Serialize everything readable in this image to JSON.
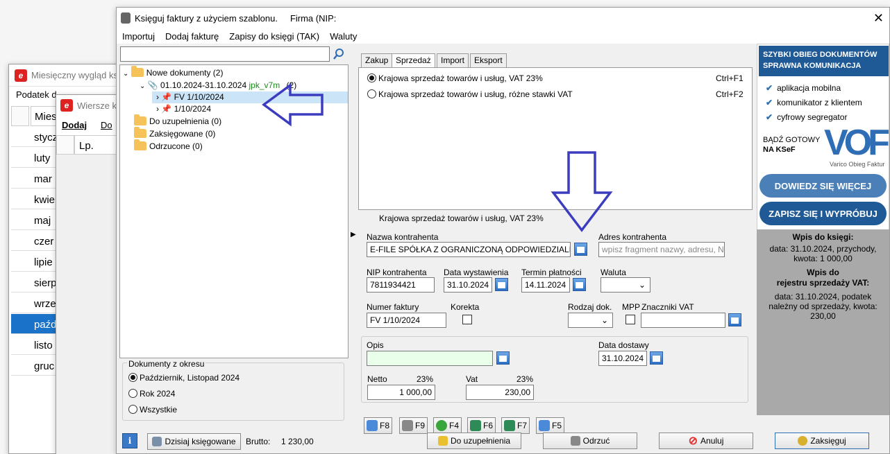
{
  "back_window": {
    "title": "Miesięczny wygląd ks",
    "menu_item": "Podatek d",
    "column_header": "Mies",
    "months": [
      "stycz",
      "luty",
      "mar",
      "kwie",
      "maj",
      "czer",
      "lipie",
      "sierp",
      "wrze",
      "paźd",
      "listo",
      "gruc"
    ],
    "selected_index": 9
  },
  "middle_window": {
    "title": "Wiersze k",
    "menu": [
      "Dodaj",
      "Do"
    ],
    "column_header": "Lp."
  },
  "main": {
    "title": "Księguj faktury z użyciem szablonu.",
    "firm_label": "Firma (NIP:",
    "menu": [
      "Importuj",
      "Dodaj fakturę",
      "Zapisy do księgi (TAK)",
      "Waluty"
    ],
    "search_placeholder": "",
    "tree": {
      "new_docs": "Nowe dokumenty (2)",
      "period": "01.10.2024-31.10.2024",
      "template": "jpk_v7m",
      "period_count": "(2)",
      "doc1": "FV 1/10/2024",
      "doc2": "1/10/2024",
      "to_complete": "Do uzupełnienia (0)",
      "booked": "Zaksięgowane (0)",
      "rejected": "Odrzucone (0)"
    },
    "period_group": {
      "legend": "Dokumenty z okresu",
      "options": [
        "Październik, Listopad 2024",
        "Rok 2024",
        "Wszystkie"
      ],
      "selected": 0
    },
    "tabs": [
      "Zakup",
      "Sprzedaż",
      "Import",
      "Eksport"
    ],
    "active_tab": 1,
    "templates": [
      {
        "label": "Krajowa sprzedaż towarów i usług, VAT 23%",
        "shortcut": "Ctrl+F1",
        "selected": true
      },
      {
        "label": "Krajowa sprzedaż towarów i usług, różne stawki VAT",
        "shortcut": "Ctrl+F2",
        "selected": false
      }
    ],
    "selected_template_caption": "Krajowa sprzedaż towarów i usług, VAT 23%",
    "form": {
      "contractor_label": "Nazwa kontrahenta",
      "contractor_value": "E-FILE SPÓŁKA Z OGRANICZONĄ ODPOWIEDZIALNOŚ",
      "address_label": "Adres kontrahenta",
      "address_placeholder": "wpisz fragment nazwy, adresu, NIP lu",
      "nip_label": "NIP kontrahenta",
      "nip_value": "7811934421",
      "issue_date_label": "Data wystawienia",
      "issue_date_value": "31.10.2024",
      "due_date_label": "Termin płatności",
      "due_date_value": "14.11.2024",
      "currency_label": "Waluta",
      "invoice_no_label": "Numer faktury",
      "invoice_no_value": "FV 1/10/2024",
      "correction_label": "Korekta",
      "doc_type_label": "Rodzaj dok.",
      "mpp_label": "MPP",
      "vat_markers_label": "Znaczniki VAT",
      "description_label": "Opis",
      "delivery_date_label": "Data dostawy",
      "delivery_date_value": "31.10.2024",
      "net_label": "Netto",
      "net_rate": "23%",
      "net_value": "1 000,00",
      "vat_label": "Vat",
      "vat_rate": "23%",
      "vat_value": "230,00"
    },
    "fkeys": [
      "F8",
      "F9",
      "F4",
      "F6",
      "F7",
      "F5"
    ],
    "bottom": {
      "booked_today": "Dzisiaj księgowane",
      "gross_label": "Brutto:",
      "gross_value": "1 230,00",
      "to_complete_btn": "Do uzupełnienia",
      "reject_btn": "Odrzuć",
      "cancel_btn": "Anuluj",
      "book_btn": "Zaksięguj"
    }
  },
  "ad": {
    "headline1": "SZYBKI OBIEG DOKUMENTÓW",
    "headline2": "SPRAWNA KOMUNIKACJA",
    "features": [
      "aplikacja mobilna",
      "komunikator z klientem",
      "cyfrowy segregator"
    ],
    "ready1": "BĄDŹ GOTOWY",
    "ready2": "NA KSeF",
    "logo_text": "Varico Obieg Faktur",
    "btn_learn": "DOWIEDZ SIĘ WIĘCEJ",
    "btn_try": "ZAPISZ SIĘ I WYPRÓBUJ"
  },
  "entry_info": {
    "book_title": "Wpis do księgi:",
    "book_text": "data: 31.10.2024, przychody, kwota: 1 000,00",
    "vat_title1": "Wpis do",
    "vat_title2": "rejestru sprzedaży VAT:",
    "vat_text": "data: 31.10.2024, podatek należny od sprzedaży, kwota: 230,00"
  },
  "colors": {
    "accent_blue": "#2f6db4",
    "arrow": "#3c3cbf",
    "ad_bg": "#ffffff",
    "ad_header": "#1f5a96",
    "info_bg": "#a9a9a9",
    "selection": "#1a73c9"
  }
}
